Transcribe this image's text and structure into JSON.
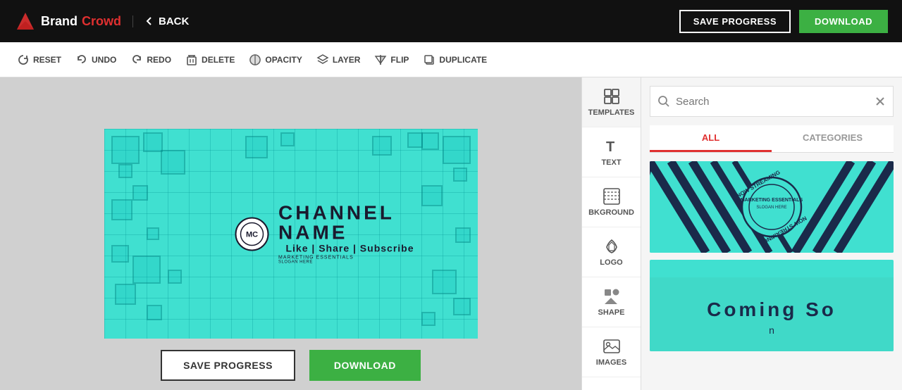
{
  "header": {
    "brand_text": "Brand",
    "crowd_text": "Crowd",
    "back_label": "BACK",
    "save_progress_label": "SAVE PROGRESS",
    "download_label": "DOWNLOAD"
  },
  "toolbar": {
    "reset_label": "RESET",
    "undo_label": "UNDO",
    "redo_label": "REDO",
    "delete_label": "DELETE",
    "opacity_label": "OPACITY",
    "layer_label": "LAYER",
    "flip_label": "FLIP",
    "duplicate_label": "DUPLICATE"
  },
  "canvas": {
    "channel_name": "CHANNEL NAME",
    "channel_sub": "Like | Share | Subscribe",
    "marketing_line1": "MARKETING ESSENTIALS",
    "marketing_line2": "SLOGAN HERE"
  },
  "icons_panel": {
    "items": [
      {
        "id": "templates",
        "label": "TEMPLATES"
      },
      {
        "id": "text",
        "label": "TEXT"
      },
      {
        "id": "bkground",
        "label": "BKGROUND"
      },
      {
        "id": "logo",
        "label": "LOGO"
      },
      {
        "id": "shape",
        "label": "SHAPE"
      },
      {
        "id": "images",
        "label": "IMAGES"
      }
    ]
  },
  "templates_panel": {
    "search_placeholder": "Search",
    "tab_all": "ALL",
    "tab_categories": "CATEGORIES"
  },
  "bottom_bar": {
    "save_progress_label": "SAVE PROGRESS",
    "download_label": "DOWNLOAD"
  }
}
